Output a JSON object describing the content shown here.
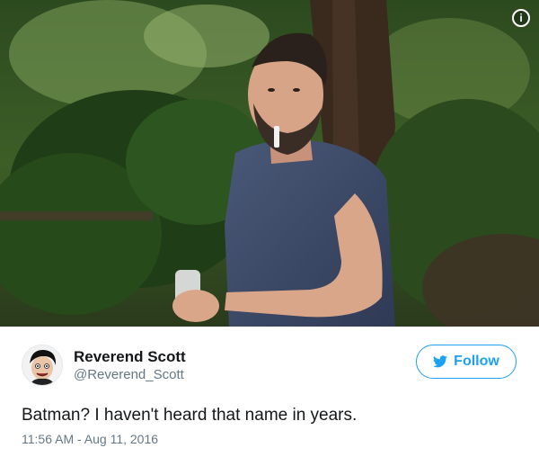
{
  "photo": {
    "alt": "",
    "info_glyph": "i",
    "info_icon": "info-icon"
  },
  "author": {
    "display_name": "Reverend Scott",
    "handle": "@Reverend_Scott",
    "avatar_icon": "cartoon-avatar"
  },
  "follow_button": {
    "label": "Follow",
    "icon": "bird-icon",
    "color": "#1da1f2"
  },
  "tweet": {
    "text": "Batman? I haven't heard that name in years.",
    "timestamp": "11:56 AM - Aug 11, 2016"
  },
  "colors": {
    "accent": "#1da1f2",
    "text_primary": "#14171a",
    "text_secondary": "#657786"
  }
}
